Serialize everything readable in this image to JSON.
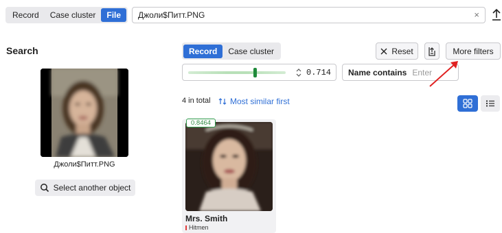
{
  "top_tabs": [
    {
      "label": "Record",
      "active": false
    },
    {
      "label": "Case cluster",
      "active": false
    },
    {
      "label": "File",
      "active": true
    }
  ],
  "file_input": {
    "value": "Джоли$Питт.PNG"
  },
  "search_panel": {
    "title": "Search",
    "filename": "Джоли$Питт.PNG",
    "select_label": "Select another object"
  },
  "result_tabs": [
    {
      "label": "Record",
      "active": true
    },
    {
      "label": "Case cluster",
      "active": false
    }
  ],
  "toolbar": {
    "reset_label": "Reset",
    "more_filters_label": "More filters"
  },
  "filters": {
    "similarity": 0.714,
    "similarity_text": "0.714",
    "name_label": "Name contains",
    "name_placeholder": "Enter"
  },
  "results": {
    "total": "4 in total",
    "sort_label": "Most similar first",
    "view_mode": "grid"
  },
  "cards": [
    {
      "score": "0.8464",
      "name": "Mrs. Smith",
      "tag": "Hitmen",
      "tag_color": "#e23c3c"
    }
  ],
  "colors": {
    "accent": "#2f6fd6",
    "score_green": "#2e8a42",
    "arrow_red": "#e02020"
  },
  "icons": [
    "clear-icon",
    "upload-icon",
    "search-icon",
    "close-icon",
    "export-icon",
    "stepper-icon",
    "sort-icon",
    "grid-icon",
    "list-icon"
  ]
}
